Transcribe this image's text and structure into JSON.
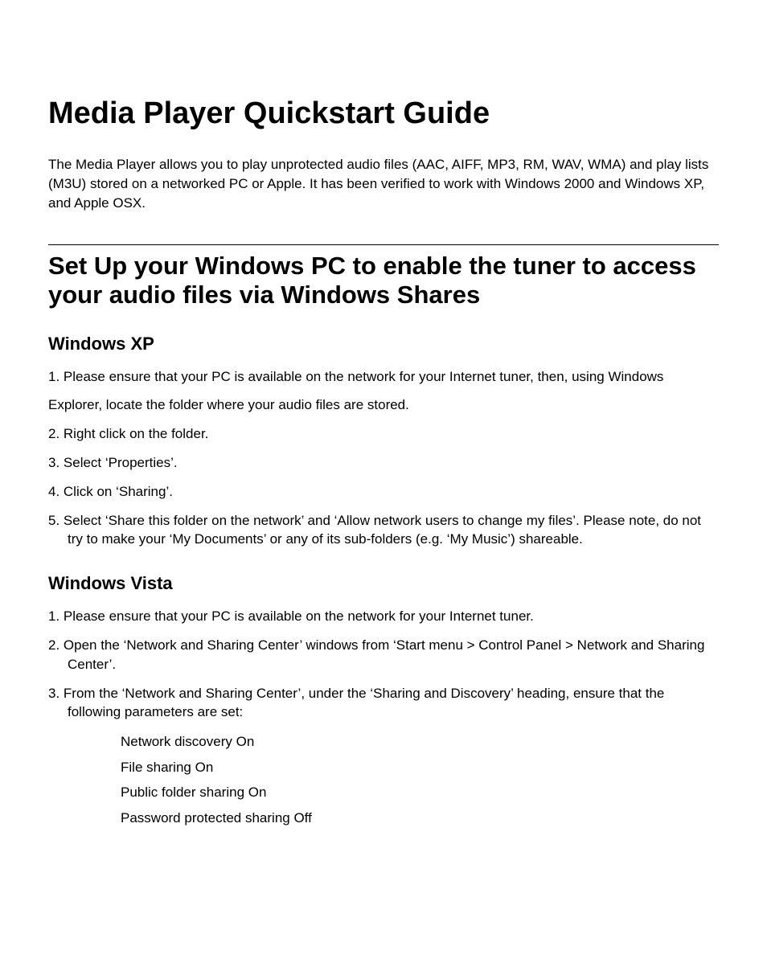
{
  "title": "Media Player Quickstart Guide",
  "intro": "The Media Player allows you to play unprotected audio files (AAC, AIFF, MP3, RM, WAV, WMA) and play lists (M3U) stored on a networked PC or Apple. It has been verified to work with Windows 2000 and Windows XP, and Apple OSX.",
  "section1": {
    "heading": "Set Up your Windows PC to enable the tuner to access your audio files via Windows Shares",
    "xp": {
      "heading": "Windows XP",
      "step1": "1. Please ensure that your PC is available on the network for your Internet tuner, then, using Windows",
      "step1b": "Explorer, locate the folder where your audio files are stored.",
      "step2": "2. Right click on the folder.",
      "step3": "3. Select ‘Properties’.",
      "step4": "4. Click on ‘Sharing’.",
      "step5": "5. Select ‘Share this folder on the network’ and ‘Allow network users to change my files’. Please note, do not try to make your ‘My Documents’ or any of its sub-folders (e.g. ‘My Music’) shareable."
    },
    "vista": {
      "heading": "Windows Vista",
      "step1": "1. Please ensure that your PC is available on the network for your Internet tuner.",
      "step2": "2. Open the ‘Network and Sharing Center’ windows from ‘Start menu > Control Panel > Network and Sharing Center’.",
      "step3": "3. From the ‘Network and Sharing Center’, under the ‘Sharing and Discovery’ heading, ensure that the following parameters are set:",
      "params": {
        "p1": "Network discovery On",
        "p2": "File sharing On",
        "p3": "Public folder sharing On",
        "p4": "Password protected sharing Off"
      }
    }
  }
}
